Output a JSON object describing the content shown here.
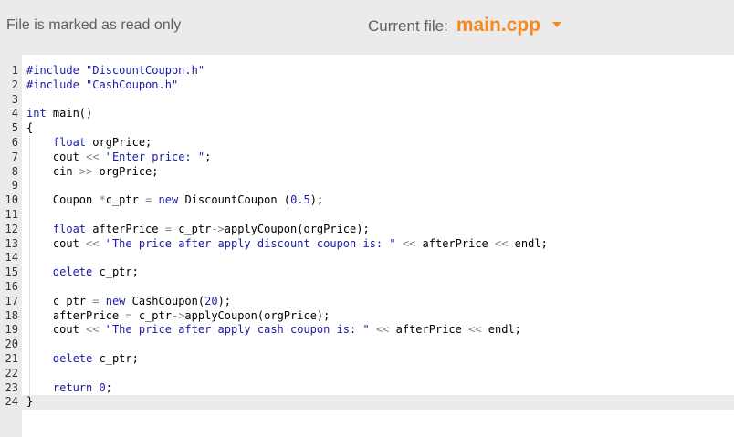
{
  "header": {
    "readonly_text": "File is marked as read only",
    "current_file_label": "Current file:",
    "current_file_name": "main.cpp",
    "accent_color": "#f28a1f"
  },
  "editor": {
    "active_line": 24,
    "lines": [
      {
        "n": "1",
        "tokens": [
          [
            "kw",
            "#include"
          ],
          [
            "t",
            " "
          ],
          [
            "str",
            "\"DiscountCoupon.h\""
          ]
        ]
      },
      {
        "n": "2",
        "tokens": [
          [
            "kw",
            "#include"
          ],
          [
            "t",
            " "
          ],
          [
            "str",
            "\"CashCoupon.h\""
          ]
        ]
      },
      {
        "n": "3",
        "tokens": []
      },
      {
        "n": "4",
        "tokens": [
          [
            "kw",
            "int"
          ],
          [
            "t",
            " main()"
          ]
        ]
      },
      {
        "n": "5",
        "tokens": [
          [
            "t",
            "{"
          ]
        ]
      },
      {
        "n": "6",
        "tokens": [
          [
            "t",
            "    "
          ],
          [
            "kw",
            "float"
          ],
          [
            "t",
            " orgPrice;"
          ]
        ]
      },
      {
        "n": "7",
        "tokens": [
          [
            "t",
            "    cout "
          ],
          [
            "op",
            "<<"
          ],
          [
            "t",
            " "
          ],
          [
            "str",
            "\"Enter price: \""
          ],
          [
            "t",
            ";"
          ]
        ]
      },
      {
        "n": "8",
        "tokens": [
          [
            "t",
            "    cin "
          ],
          [
            "op",
            ">>"
          ],
          [
            "t",
            " orgPrice;"
          ]
        ]
      },
      {
        "n": "9",
        "tokens": []
      },
      {
        "n": "10",
        "tokens": [
          [
            "t",
            "    Coupon "
          ],
          [
            "op",
            "*"
          ],
          [
            "t",
            "c_ptr "
          ],
          [
            "op",
            "="
          ],
          [
            "t",
            " "
          ],
          [
            "kw",
            "new"
          ],
          [
            "t",
            " DiscountCoupon ("
          ],
          [
            "num",
            "0.5"
          ],
          [
            "t",
            ");"
          ]
        ]
      },
      {
        "n": "11",
        "tokens": []
      },
      {
        "n": "12",
        "tokens": [
          [
            "t",
            "    "
          ],
          [
            "kw",
            "float"
          ],
          [
            "t",
            " afterPrice "
          ],
          [
            "op",
            "="
          ],
          [
            "t",
            " c_ptr"
          ],
          [
            "op",
            "->"
          ],
          [
            "t",
            "applyCoupon(orgPrice);"
          ]
        ]
      },
      {
        "n": "13",
        "tokens": [
          [
            "t",
            "    cout "
          ],
          [
            "op",
            "<<"
          ],
          [
            "t",
            " "
          ],
          [
            "str",
            "\"The price after apply discount coupon is: \""
          ],
          [
            "t",
            " "
          ],
          [
            "op",
            "<<"
          ],
          [
            "t",
            " afterPrice "
          ],
          [
            "op",
            "<<"
          ],
          [
            "t",
            " endl;"
          ]
        ]
      },
      {
        "n": "14",
        "tokens": []
      },
      {
        "n": "15",
        "tokens": [
          [
            "t",
            "    "
          ],
          [
            "kw",
            "delete"
          ],
          [
            "t",
            " c_ptr;"
          ]
        ]
      },
      {
        "n": "16",
        "tokens": []
      },
      {
        "n": "17",
        "tokens": [
          [
            "t",
            "    c_ptr "
          ],
          [
            "op",
            "="
          ],
          [
            "t",
            " "
          ],
          [
            "kw",
            "new"
          ],
          [
            "t",
            " CashCoupon("
          ],
          [
            "num",
            "20"
          ],
          [
            "t",
            ");"
          ]
        ]
      },
      {
        "n": "18",
        "tokens": [
          [
            "t",
            "    afterPrice "
          ],
          [
            "op",
            "="
          ],
          [
            "t",
            " c_ptr"
          ],
          [
            "op",
            "->"
          ],
          [
            "t",
            "applyCoupon(orgPrice);"
          ]
        ]
      },
      {
        "n": "19",
        "tokens": [
          [
            "t",
            "    cout "
          ],
          [
            "op",
            "<<"
          ],
          [
            "t",
            " "
          ],
          [
            "str",
            "\"The price after apply cash coupon is: \""
          ],
          [
            "t",
            " "
          ],
          [
            "op",
            "<<"
          ],
          [
            "t",
            " afterPrice "
          ],
          [
            "op",
            "<<"
          ],
          [
            "t",
            " endl;"
          ]
        ]
      },
      {
        "n": "20",
        "tokens": []
      },
      {
        "n": "21",
        "tokens": [
          [
            "t",
            "    "
          ],
          [
            "kw",
            "delete"
          ],
          [
            "t",
            " c_ptr;"
          ]
        ]
      },
      {
        "n": "22",
        "tokens": []
      },
      {
        "n": "23",
        "tokens": [
          [
            "t",
            "    "
          ],
          [
            "kw",
            "return"
          ],
          [
            "t",
            " "
          ],
          [
            "num",
            "0"
          ],
          [
            "t",
            ";"
          ]
        ]
      },
      {
        "n": "24",
        "tokens": [
          [
            "t",
            "}"
          ]
        ]
      }
    ]
  }
}
